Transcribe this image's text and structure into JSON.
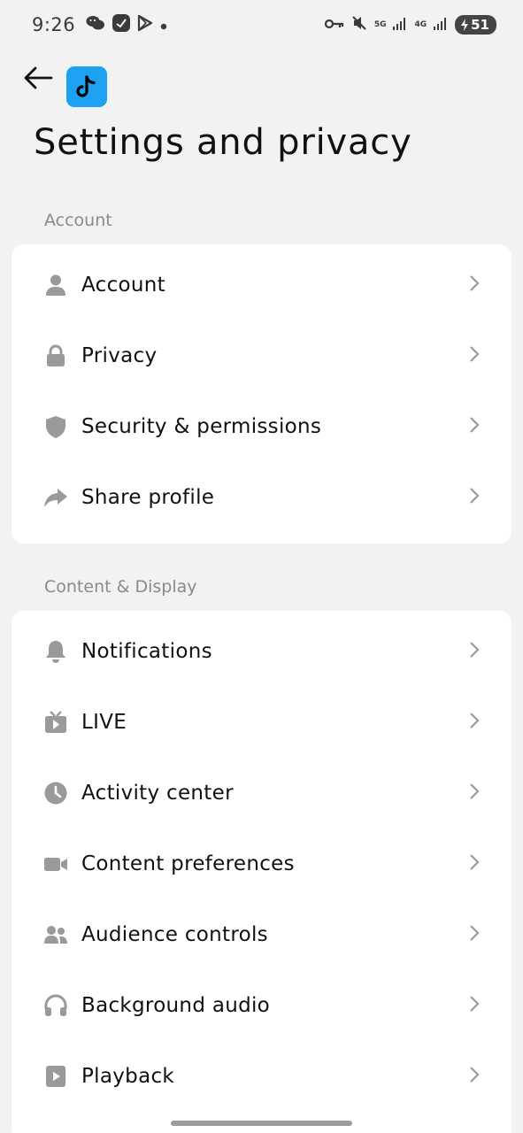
{
  "status_bar": {
    "time": "9:26",
    "net_5g": "5G",
    "net_4g": "4G",
    "battery": "51",
    "icons": [
      "wechat-icon",
      "app-badge-icon",
      "play-store-icon",
      "dot-icon",
      "key-icon",
      "mute-icon",
      "signal-icon",
      "signal-icon",
      "battery-charging-icon"
    ]
  },
  "header": {
    "back_icon": "back-arrow-icon",
    "app_icon": "tiktok-logo-icon",
    "title": "Settings and privacy"
  },
  "sections": [
    {
      "label": "Account",
      "items": [
        {
          "label": "Account",
          "icon": "person-icon"
        },
        {
          "label": "Privacy",
          "icon": "lock-icon"
        },
        {
          "label": "Security & permissions",
          "icon": "shield-icon"
        },
        {
          "label": "Share profile",
          "icon": "share-arrow-icon"
        }
      ]
    },
    {
      "label": "Content & Display",
      "items": [
        {
          "label": "Notifications",
          "icon": "bell-icon"
        },
        {
          "label": "LIVE",
          "icon": "live-tv-icon"
        },
        {
          "label": "Activity center",
          "icon": "clock-icon"
        },
        {
          "label": "Content preferences",
          "icon": "video-camera-icon"
        },
        {
          "label": "Audience controls",
          "icon": "people-icon"
        },
        {
          "label": "Background audio",
          "icon": "headphones-icon"
        },
        {
          "label": "Playback",
          "icon": "play-icon"
        }
      ]
    }
  ],
  "colors": {
    "background": "#f2f2f2",
    "card": "#ffffff",
    "icon_gray": "#9a9a9a",
    "section_label": "#8a8a8a",
    "app_logo": "#1da1f2"
  }
}
